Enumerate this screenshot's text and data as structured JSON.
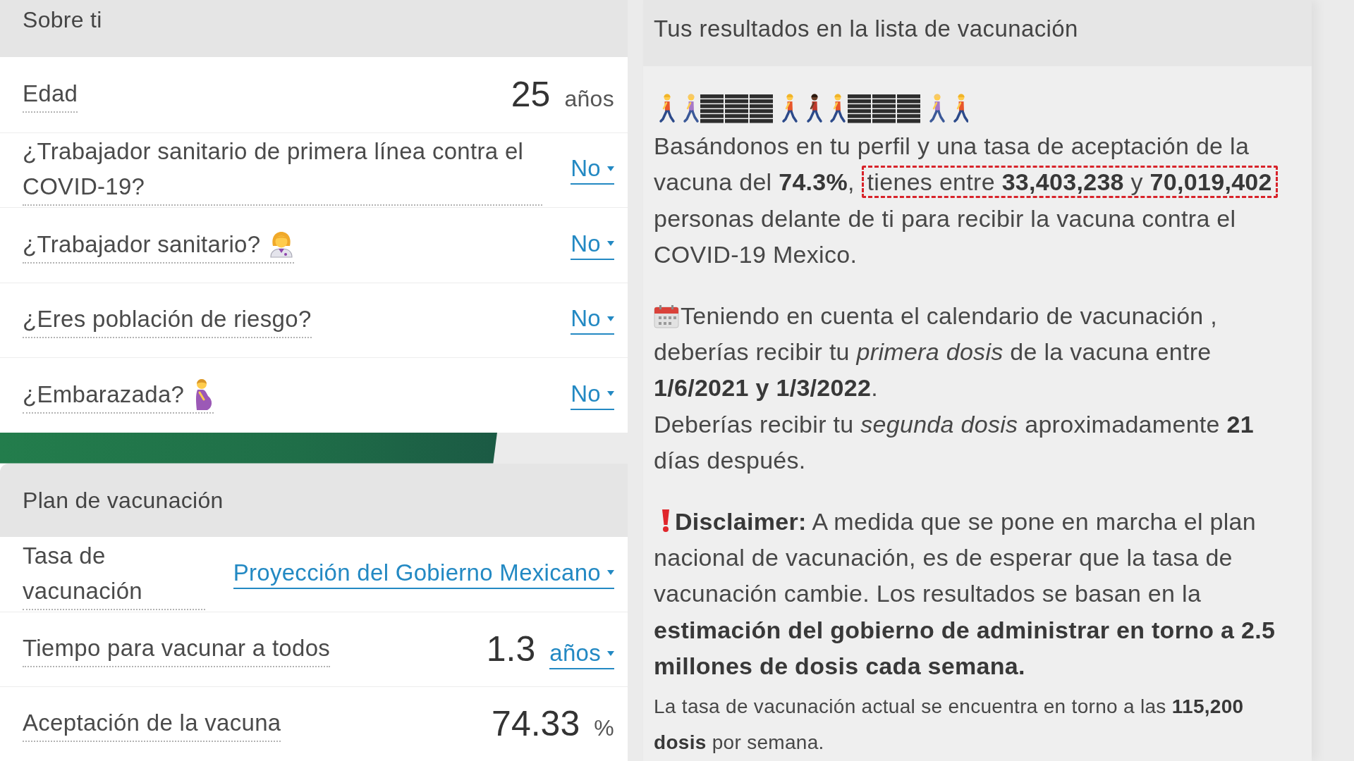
{
  "sections": [
    {
      "title": "Sobre ti",
      "rows": [
        {
          "kind": "number",
          "label": "Edad",
          "value": "25",
          "unit": "años"
        },
        {
          "kind": "dropdown",
          "label": "¿Trabajador sanitario de primera línea contra el COVID-19?",
          "choice": "No"
        },
        {
          "kind": "dropdown",
          "label": "¿Trabajador sanitario?",
          "choice": "No"
        },
        {
          "kind": "dropdown",
          "label": "¿Eres población de riesgo?",
          "choice": "No"
        },
        {
          "kind": "dropdown",
          "label": "¿Embarazada?",
          "choice": "No"
        }
      ]
    },
    {
      "title": "Plan de vacunación",
      "rows": [
        {
          "kind": "dropdown",
          "label": "Tasa de vacunación",
          "choice": "Proyección del Gobierno Mexicano"
        },
        {
          "kind": "number_dropdown",
          "label": "Tiempo para vacunar a todos",
          "value": "1.3",
          "choice": "años"
        },
        {
          "kind": "number",
          "label": "Aceptación de la vacuna",
          "value": "74.33",
          "unit": "%"
        }
      ]
    }
  ],
  "results": {
    "title": "Tus resultados en la lista de vacunación",
    "summary": {
      "text_before": "Basándonos en tu perfil y una tasa de aceptación de la vacuna del **74.3%**,",
      "highlighted": "tienes entre **33,403,238** y **70,019,402**",
      "text_after": "personas delante de ti para recibir la vacuna contra el COVID-19 Mexico."
    },
    "schedule": [
      "Teniendo en cuenta el calendario de vacunación , deberías recibir tu *primera dosis* de la vacuna entre **1/6/2021 y 1/3/2022**.",
      "Deberías recibir tu *segunda dosis* aproximadamente **21** días después."
    ],
    "disclaimer": "**Disclaimer:** A medida que se pone en marcha el plan nacional de vacunación, es de esperar que la tasa de vacunación cambie. Los resultados se basan en la **estimación del gobierno de administrar en torno a 2.5 millones de dosis cada semana.**",
    "note": "La tasa de vacunación actual se encuentra en torno a las **115,200 dosis** por semana."
  }
}
